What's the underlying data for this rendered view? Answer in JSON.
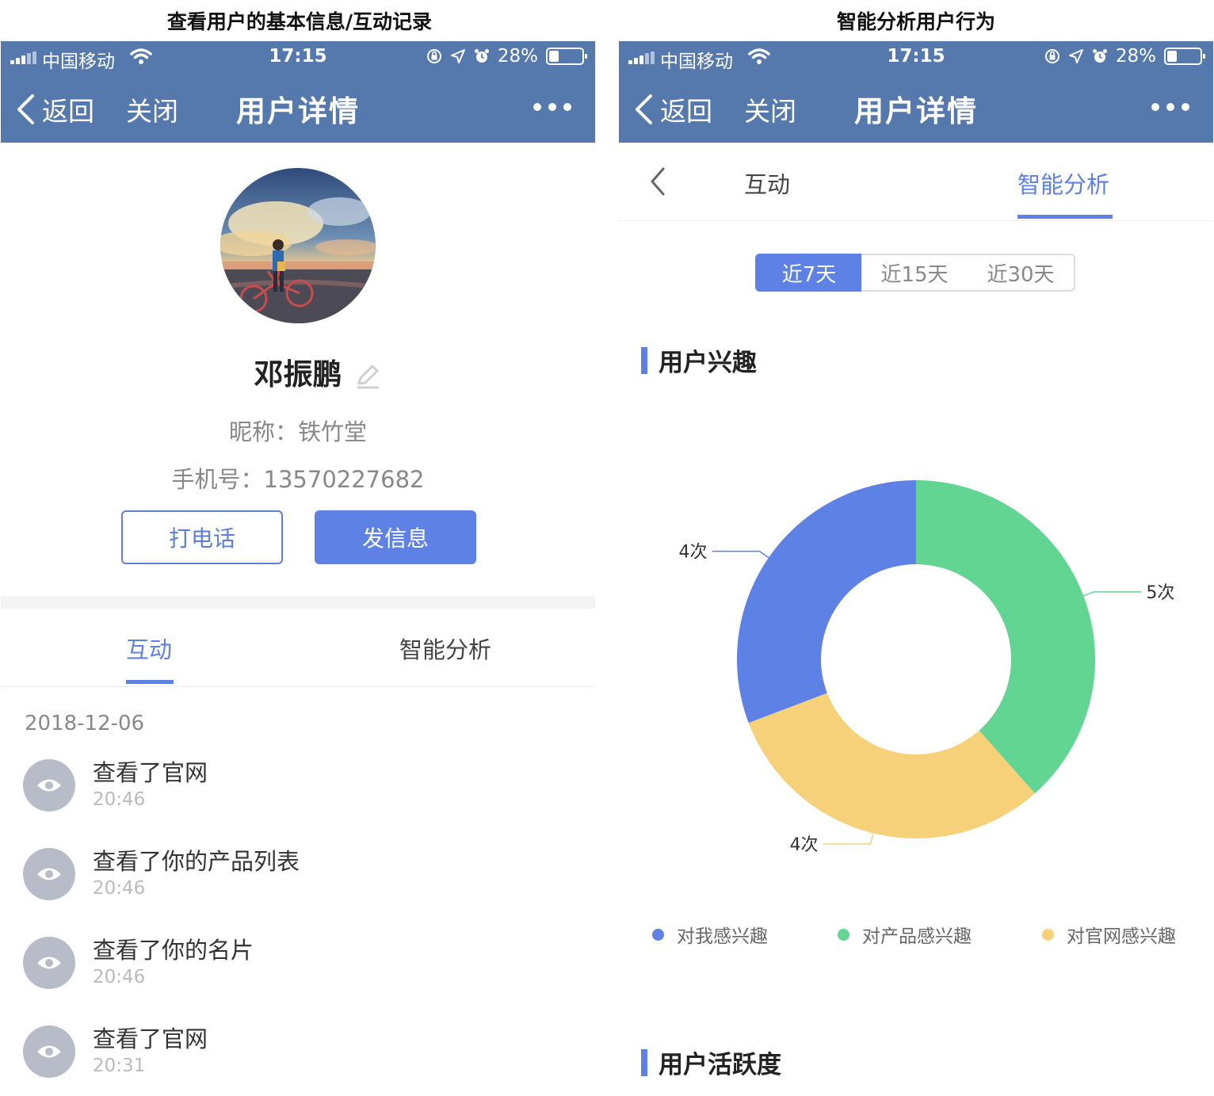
{
  "captions": {
    "left": "查看用户的基本信息/互动记录",
    "right": "智能分析用户行为"
  },
  "status_bar": {
    "carrier": "中国移动",
    "time": "17:15",
    "battery": "28%"
  },
  "nav": {
    "back_label": "返回",
    "close_label": "关闭",
    "title": "用户详情"
  },
  "profile": {
    "name": "邓振鹏",
    "nickname": "昵称：铁竹堂",
    "phone": "手机号：13570227682",
    "call_label": "打电话",
    "message_label": "发信息"
  },
  "tabs": {
    "interaction": "互动",
    "analysis": "智能分析"
  },
  "activity": {
    "date": "2018-12-06",
    "items": [
      {
        "title": "查看了官网",
        "time": "20:46"
      },
      {
        "title": "查看了你的产品列表",
        "time": "20:46"
      },
      {
        "title": "查看了你的名片",
        "time": "20:46"
      },
      {
        "title": "查看了官网",
        "time": "20:31"
      }
    ]
  },
  "analysis": {
    "ranges": [
      "近7天",
      "近15天",
      "近30天"
    ],
    "selected_range": "近7天",
    "interest_title": "用户兴趣",
    "activity_title": "用户活跃度",
    "colors": {
      "blue": "#5e81e5",
      "green": "#62d592",
      "yellow": "#f7d179"
    }
  },
  "chart_data": {
    "type": "pie",
    "title": "用户兴趣",
    "legend_position": "bottom",
    "series": [
      {
        "name": "对产品感兴趣",
        "value": 5,
        "label": "5次",
        "color": "#62d592"
      },
      {
        "name": "对官网感兴趣",
        "value": 4,
        "label": "4次",
        "color": "#f7d179"
      },
      {
        "name": "对我感兴趣",
        "value": 4,
        "label": "4次",
        "color": "#5e81e5"
      }
    ],
    "legend_order": [
      "对我感兴趣",
      "对产品感兴趣",
      "对官网感兴趣"
    ]
  }
}
